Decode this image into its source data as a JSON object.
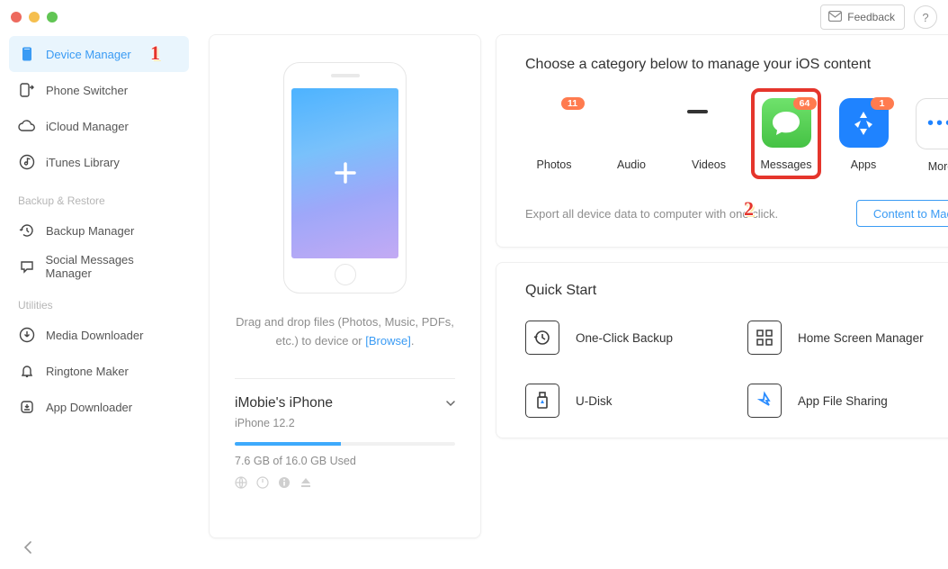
{
  "titlebar": {
    "feedback_label": "Feedback",
    "help_label": "?"
  },
  "sidebar": {
    "items": [
      {
        "label": "Device Manager",
        "selected": true
      },
      {
        "label": "Phone Switcher"
      },
      {
        "label": "iCloud Manager"
      },
      {
        "label": "iTunes Library"
      }
    ],
    "section_backup": "Backup & Restore",
    "backup_items": [
      {
        "label": "Backup Manager"
      },
      {
        "label": "Social Messages Manager"
      }
    ],
    "section_util": "Utilities",
    "util_items": [
      {
        "label": "Media Downloader"
      },
      {
        "label": "Ringtone Maker"
      },
      {
        "label": "App Downloader"
      }
    ]
  },
  "drop": {
    "line1": "Drag and drop files (Photos, Music, PDFs,",
    "line2_a": "etc.) to device or ",
    "line2_b": "[Browse]",
    "line2_c": "."
  },
  "device": {
    "name": "iMobie's iPhone",
    "os": "iPhone 12.2",
    "storage_pct": 48,
    "storage_label": "7.6 GB of  16.0 GB Used"
  },
  "categories": {
    "title": "Choose a category below to manage your iOS content",
    "items": [
      {
        "label": "Photos",
        "badge": "11"
      },
      {
        "label": "Audio",
        "badge": null
      },
      {
        "label": "Videos",
        "badge": null
      },
      {
        "label": "Messages",
        "badge": "64"
      },
      {
        "label": "Apps",
        "badge": "1"
      },
      {
        "label": "More",
        "badge": null
      }
    ],
    "export_text": "Export all device data to computer with one click.",
    "export_btn": "Content to Mac"
  },
  "quickstart": {
    "title": "Quick Start",
    "items": [
      {
        "label": "One-Click Backup"
      },
      {
        "label": "Home Screen Manager"
      },
      {
        "label": "U-Disk"
      },
      {
        "label": "App File Sharing"
      }
    ]
  },
  "steps": {
    "one": "1",
    "two": "2"
  }
}
